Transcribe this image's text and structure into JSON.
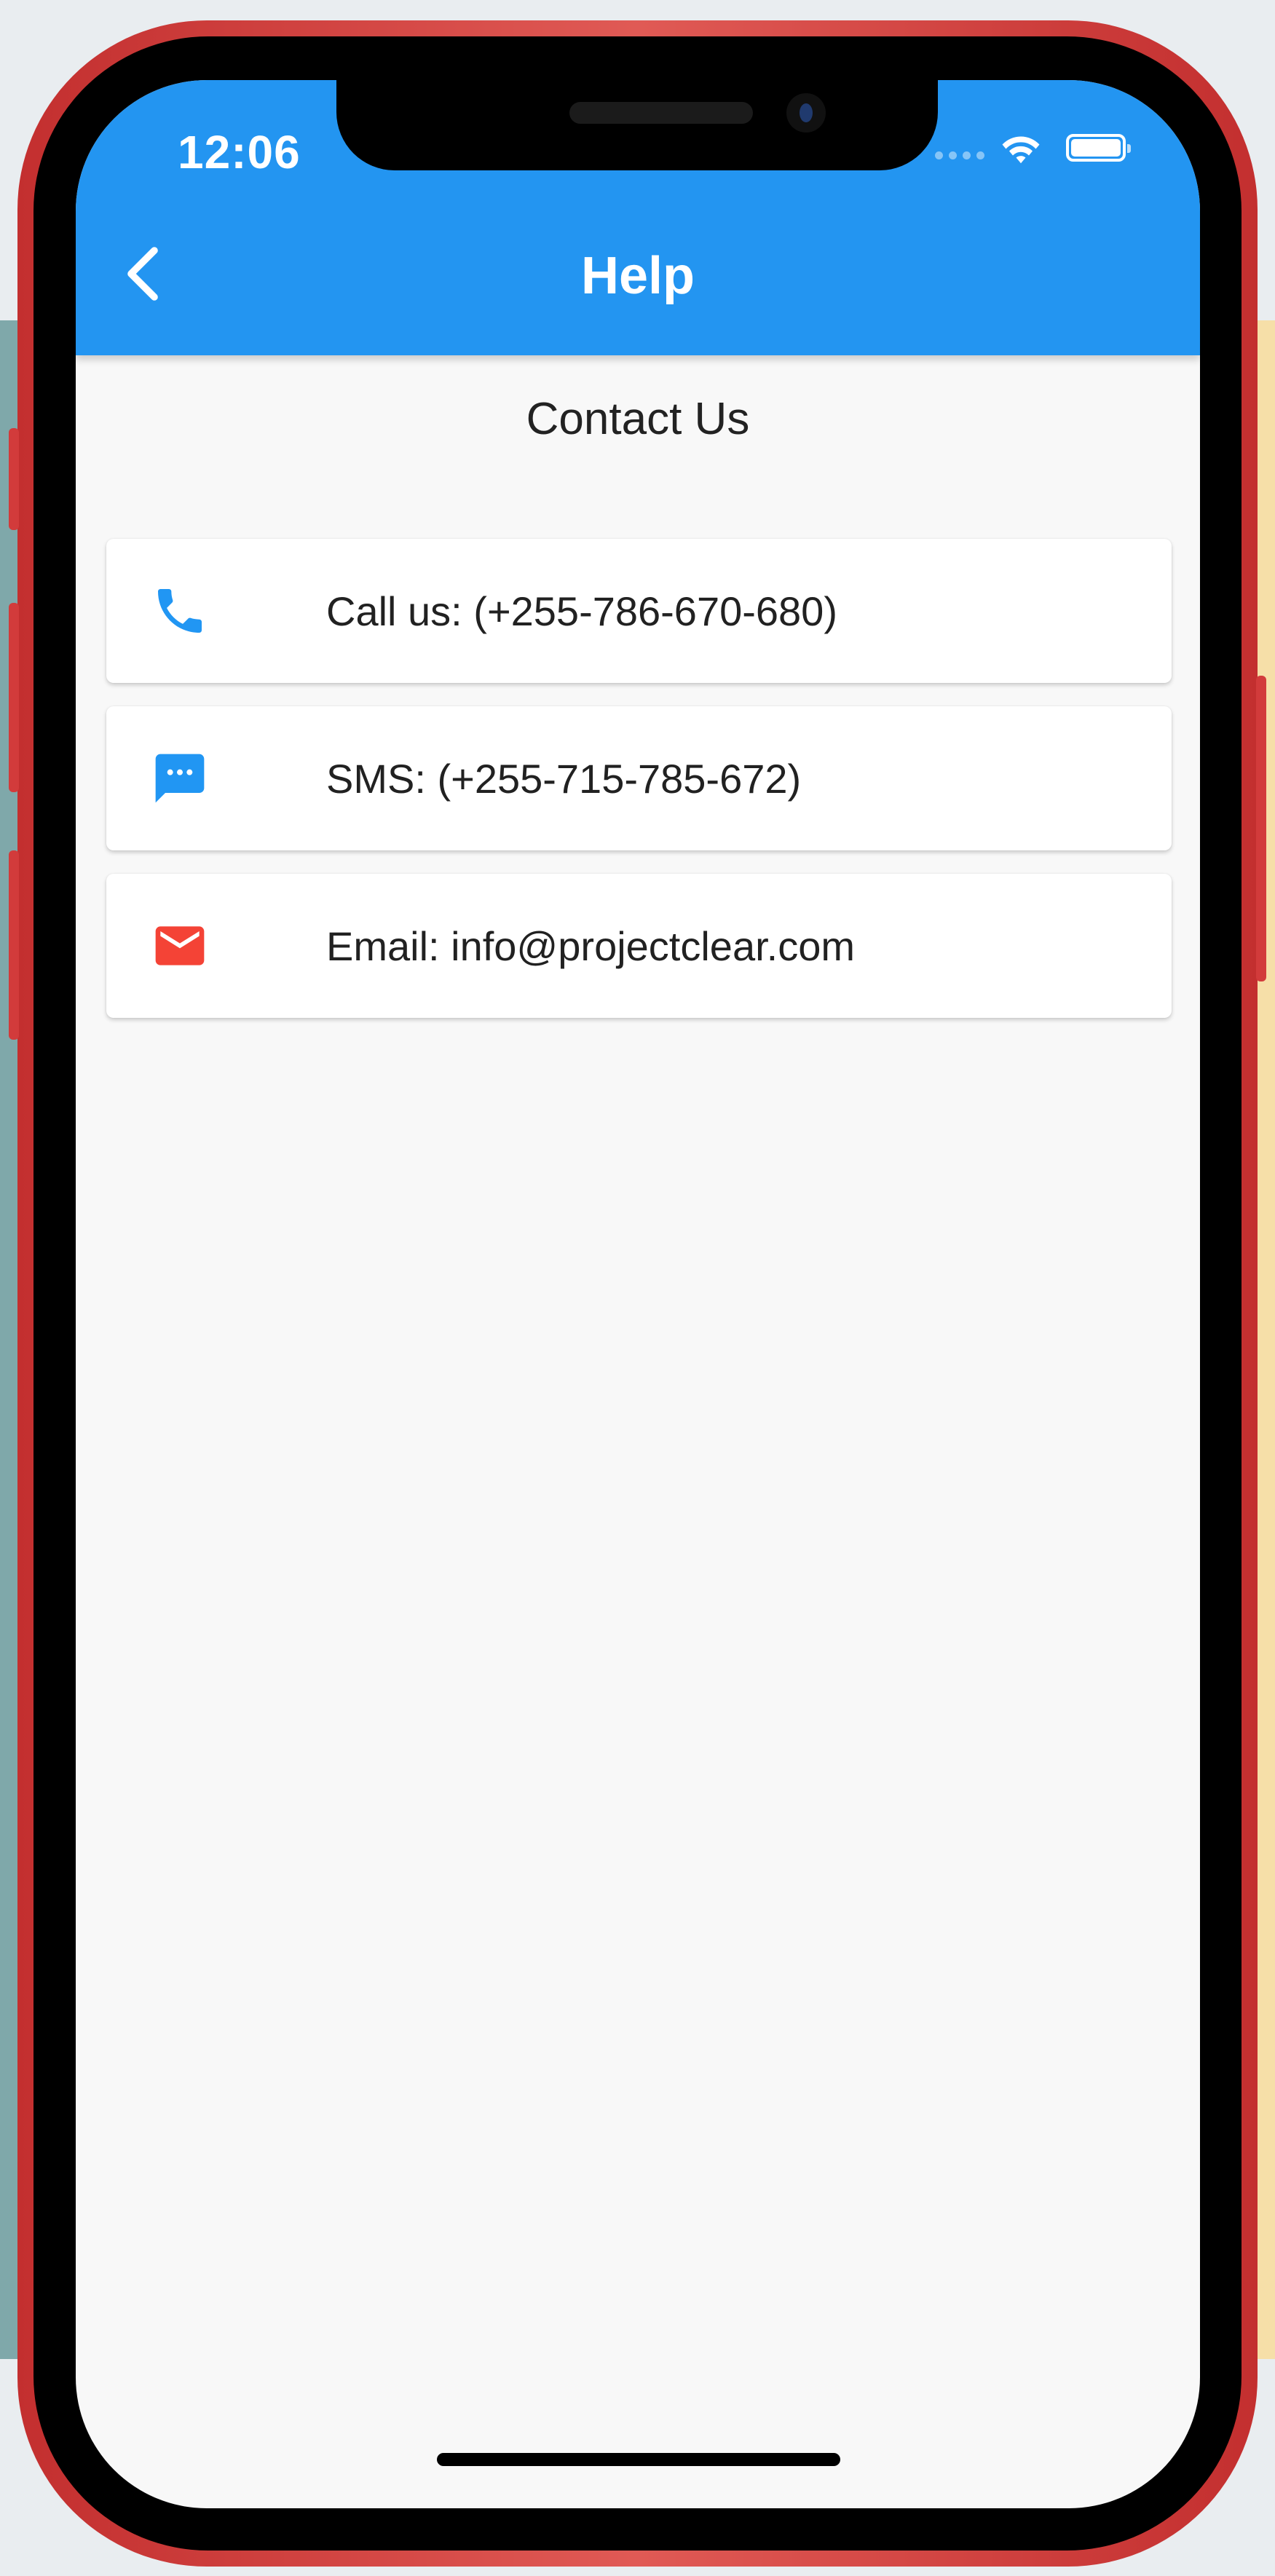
{
  "status_bar": {
    "time": "12:06"
  },
  "app_bar": {
    "title": "Help",
    "color": "#2395f1"
  },
  "page": {
    "section_title": "Contact Us"
  },
  "contacts": [
    {
      "icon": "phone-icon",
      "label": "Call us: (+255-786-670-680)",
      "icon_color": "#2196f3"
    },
    {
      "icon": "sms-icon",
      "label": "SMS: (+255-715-785-672)",
      "icon_color": "#2196f3"
    },
    {
      "icon": "email-icon",
      "label": "Email: info@projectclear.com",
      "icon_color": "#f44336"
    }
  ],
  "frame": {
    "color": "#c32f2f"
  }
}
